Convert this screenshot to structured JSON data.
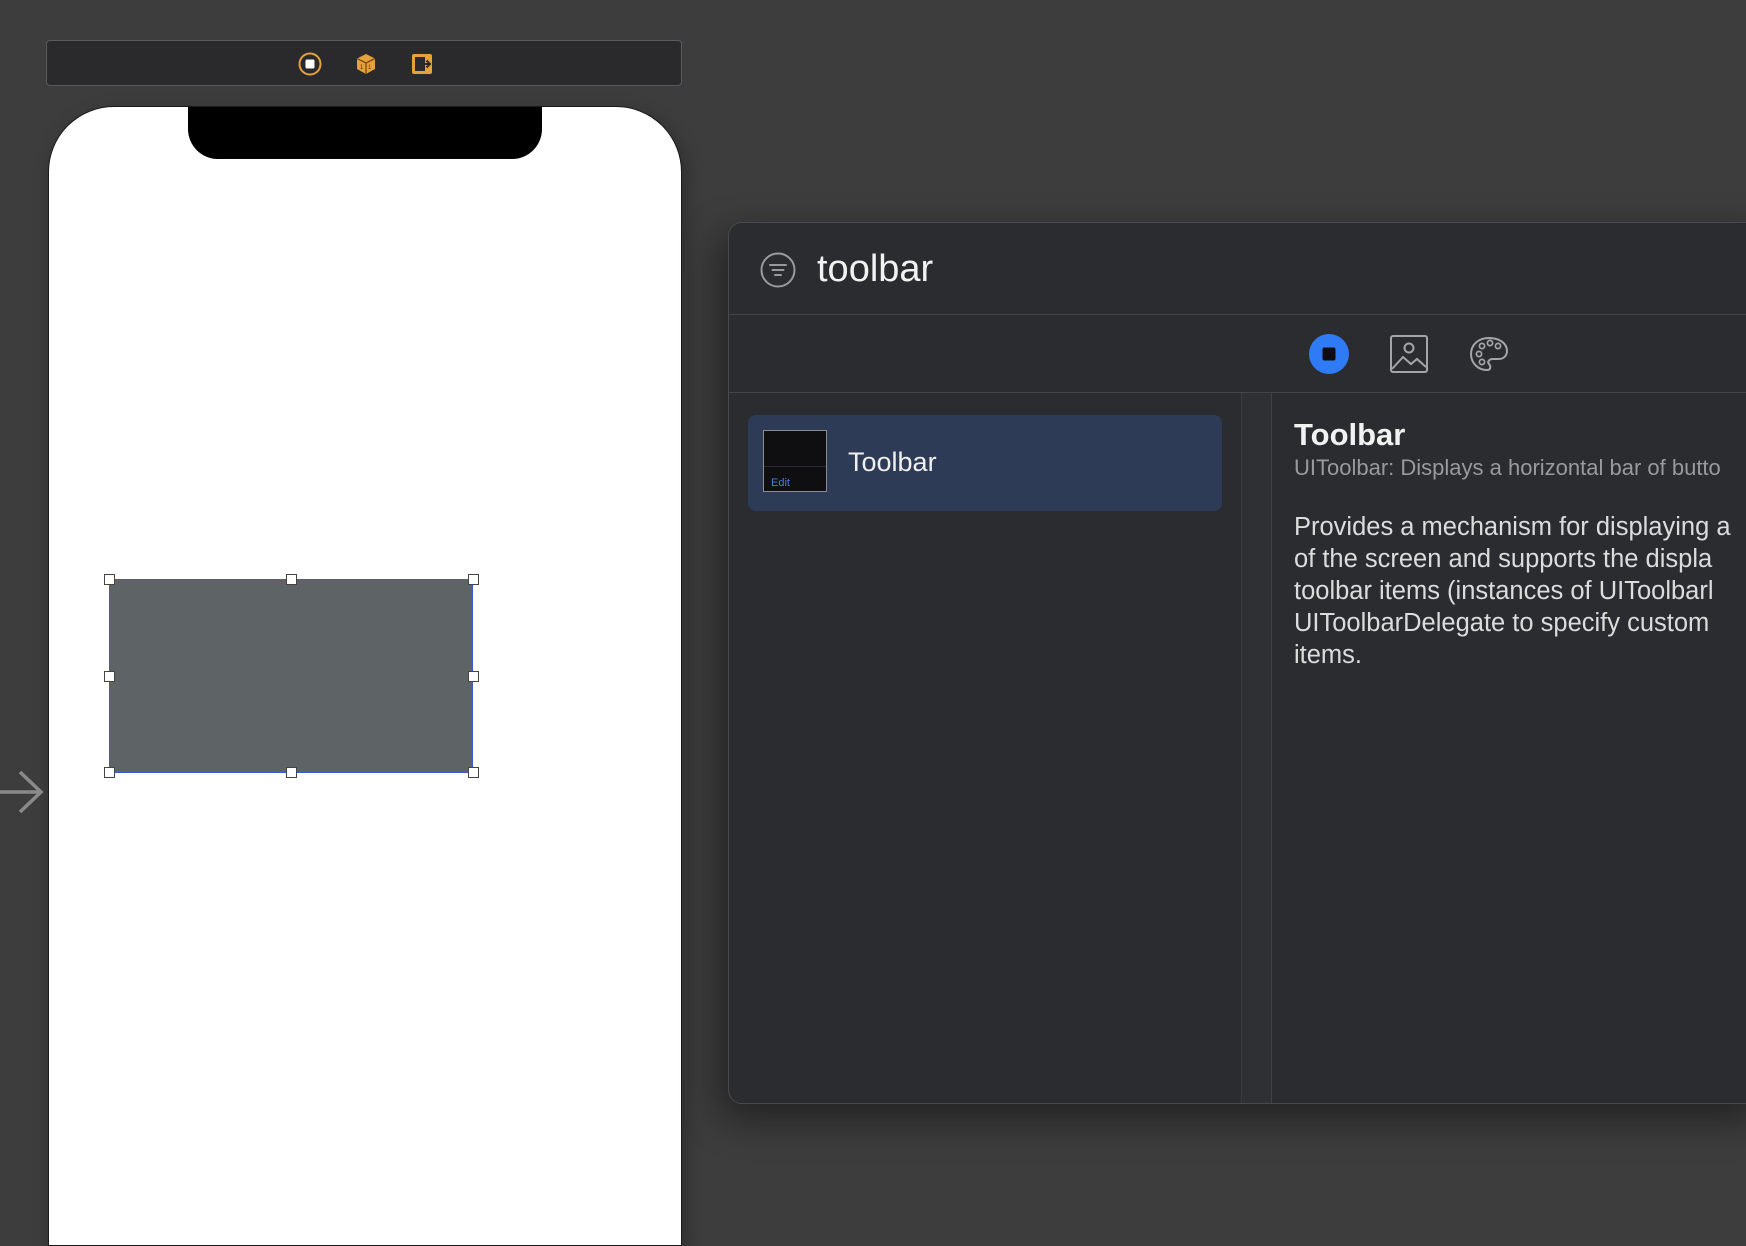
{
  "scene_dock": {
    "icons": [
      "view-controller-icon",
      "first-responder-icon",
      "exit-icon"
    ]
  },
  "library": {
    "search": {
      "value": "toolbar"
    },
    "segments": [
      {
        "name": "objects-icon",
        "selected": true
      },
      {
        "name": "media-icon",
        "selected": false
      },
      {
        "name": "colors-icon",
        "selected": false
      }
    ],
    "results": [
      {
        "label": "Toolbar",
        "thumbnail_text": "Edit",
        "selected": true
      }
    ],
    "detail": {
      "title": "Toolbar",
      "subtitle": "UIToolbar: Displays a horizontal bar of butto",
      "description_lines": [
        "Provides a mechanism for displaying a",
        "of the screen and supports the displa",
        "toolbar items (instances of UIToolbarl",
        "UIToolbarDelegate to specify custom",
        "items."
      ]
    }
  },
  "colors": {
    "accent": "#2f7bf6",
    "selection": "#2d3b56",
    "canvas": "#3d3d3d",
    "panel": "#2b2c2f",
    "dock_icon": "#e5a13a"
  }
}
